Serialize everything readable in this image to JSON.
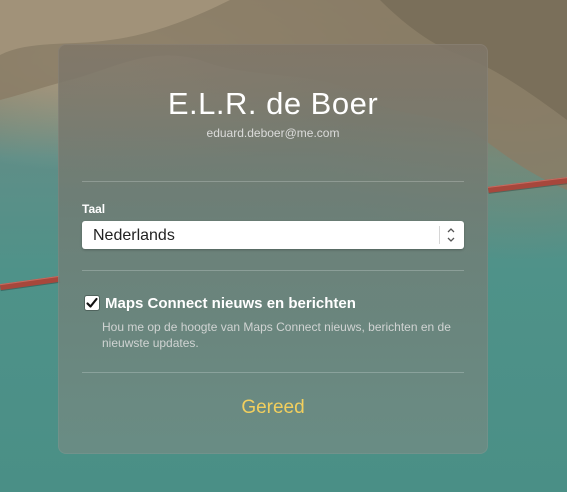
{
  "user": {
    "name": "E.L.R. de Boer",
    "email": "eduard.deboer@me.com"
  },
  "language": {
    "label": "Taal",
    "selected": "Nederlands"
  },
  "newsletter": {
    "checked": true,
    "label": "Maps Connect nieuws en berichten",
    "description": "Hou me op de hoogte van Maps Connect nieuws, berichten en de nieuwste updates."
  },
  "actions": {
    "done_label": "Gereed"
  },
  "colors": {
    "done": "#f2cf5e",
    "bridge": "#a7473c"
  },
  "icons": {
    "select": "chevron-up-down-icon",
    "checkbox": "checkmark-icon"
  }
}
